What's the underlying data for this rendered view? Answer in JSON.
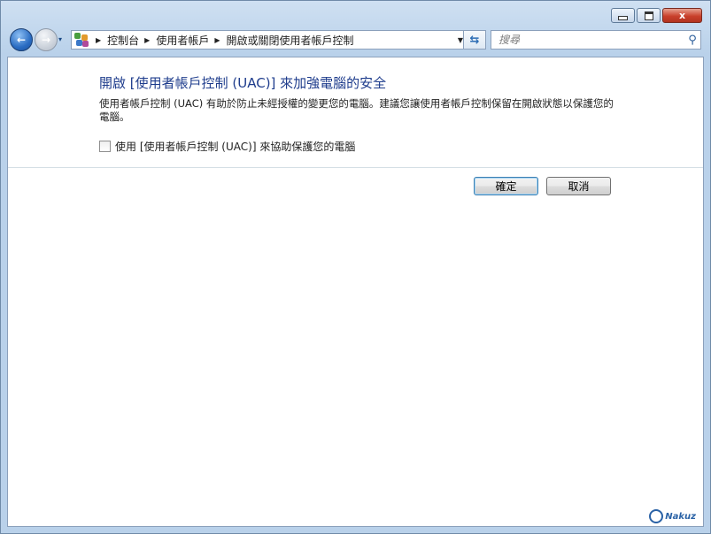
{
  "window": {
    "caption": {
      "minimize": "",
      "maximize": "",
      "close": "x"
    }
  },
  "nav": {
    "back_glyph": "←",
    "forward_glyph": "→",
    "recent_glyph": "▾",
    "breadcrumb": [
      "控制台",
      "使用者帳戶",
      "開啟或關閉使用者帳戶控制"
    ],
    "search_placeholder": "搜尋"
  },
  "content": {
    "heading": "開啟 [使用者帳戶控制 (UAC)] 來加強電腦的安全",
    "description": "使用者帳戶控制 (UAC) 有助於防止未經授權的變更您的電腦。建議您讓使用者帳戶控制保留在開啟狀態以保護您的電腦。",
    "checkbox_label": "使用 [使用者帳戶控制 (UAC)] 來協助保護您的電腦",
    "checkbox_checked": false,
    "ok_label": "確定",
    "cancel_label": "取消"
  },
  "watermark": {
    "text": "Nakuz"
  },
  "colors": {
    "heading": "#1e3c8c",
    "default_button_border": "#3c7fb1",
    "close_button": "#c9412c"
  }
}
